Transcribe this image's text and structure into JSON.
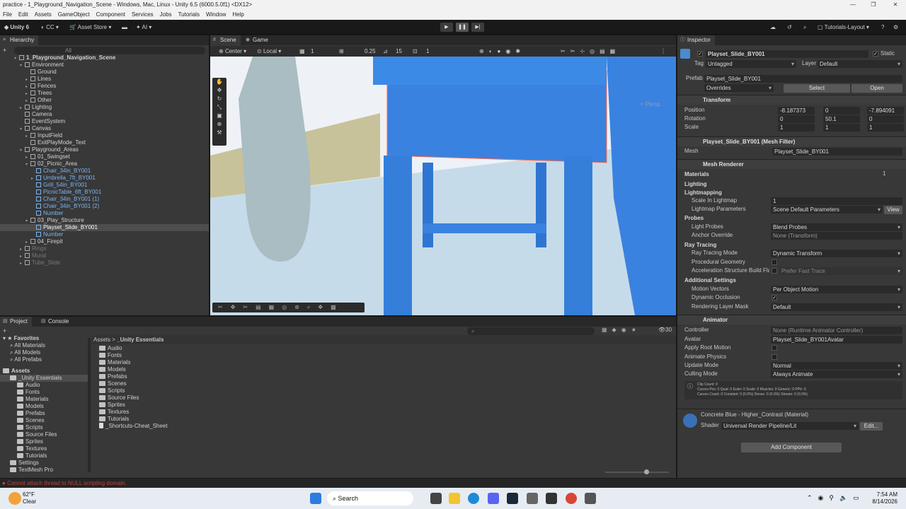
{
  "title": "practice - 1_Playground_Navigation_Scene - Windows, Mac, Linux - Unity 6.5 (6000.5.0f1) <DX12>",
  "menu": [
    "File",
    "Edit",
    "Assets",
    "GameObject",
    "Component",
    "Services",
    "Jobs",
    "Tutorials",
    "Window",
    "Help"
  ],
  "toolbar": {
    "unity": "Unity 6",
    "cc": "CC",
    "asset_store": "Asset Store",
    "ai": "AI",
    "layout": "Tutorials-Layout"
  },
  "hierarchy": {
    "tab": "Hierarchy",
    "search": "All",
    "rows": [
      {
        "t": "1_Playground_Navigation_Scene",
        "d": 0,
        "c": "",
        "a": "▾"
      },
      {
        "t": "Environment",
        "d": 1,
        "c": "",
        "a": "▾"
      },
      {
        "t": "Ground",
        "d": 2,
        "c": "",
        "a": ""
      },
      {
        "t": "Lines",
        "d": 2,
        "c": "",
        "a": "▸"
      },
      {
        "t": "Fences",
        "d": 2,
        "c": "",
        "a": "▸"
      },
      {
        "t": "Trees",
        "d": 2,
        "c": "",
        "a": "▸"
      },
      {
        "t": "Other",
        "d": 2,
        "c": "",
        "a": "▸"
      },
      {
        "t": "Lighting",
        "d": 1,
        "c": "",
        "a": "▸"
      },
      {
        "t": "Camera",
        "d": 1,
        "c": "",
        "a": ""
      },
      {
        "t": "EventSystem",
        "d": 1,
        "c": "",
        "a": ""
      },
      {
        "t": "Canvas",
        "d": 1,
        "c": "",
        "a": "▾"
      },
      {
        "t": "InputField",
        "d": 2,
        "c": "",
        "a": "▸"
      },
      {
        "t": "ExitPlayMode_Text",
        "d": 2,
        "c": "",
        "a": ""
      },
      {
        "t": "Playground_Areas",
        "d": 1,
        "c": "",
        "a": "▾"
      },
      {
        "t": "01_Swingset",
        "d": 2,
        "c": "",
        "a": "▸"
      },
      {
        "t": "02_Picnic_Area",
        "d": 2,
        "c": "",
        "a": "▾"
      },
      {
        "t": "Chair_34in_BY001",
        "d": 3,
        "c": "blue",
        "a": ""
      },
      {
        "t": "Umbrella_7ft_BY001",
        "d": 3,
        "c": "blue",
        "a": "▸"
      },
      {
        "t": "Grill_54in_BY001",
        "d": 3,
        "c": "blue",
        "a": ""
      },
      {
        "t": "PicnicTable_6ft_BY001",
        "d": 3,
        "c": "blue",
        "a": ""
      },
      {
        "t": "Chair_34in_BY001 (1)",
        "d": 3,
        "c": "blue",
        "a": ""
      },
      {
        "t": "Chair_34in_BY001 (2)",
        "d": 3,
        "c": "blue",
        "a": ""
      },
      {
        "t": "Number",
        "d": 3,
        "c": "blue",
        "a": ""
      },
      {
        "t": "03_Play_Structure",
        "d": 2,
        "c": "",
        "a": "▾"
      },
      {
        "t": "Playset_Slide_BY001",
        "d": 3,
        "c": "sel",
        "a": ""
      },
      {
        "t": "Number",
        "d": 3,
        "c": "blue",
        "a": ""
      },
      {
        "t": "04_Firepit",
        "d": 2,
        "c": "",
        "a": "▸"
      },
      {
        "t": "Rings",
        "d": 1,
        "c": "dim",
        "a": "▸"
      },
      {
        "t": "Mural",
        "d": 1,
        "c": "dim",
        "a": "▸"
      },
      {
        "t": "Tube_Slide",
        "d": 1,
        "c": "dim",
        "a": "▸"
      }
    ]
  },
  "scene": {
    "tab_scene": "Scene",
    "tab_game": "Game",
    "pivot": "Center",
    "space": "Local",
    "grid": "1",
    "snap": "0.25",
    "angle": "15",
    "scale": "1",
    "persp": "< Persp"
  },
  "project": {
    "tab_project": "Project",
    "tab_console": "Console",
    "count": "30",
    "favorites": [
      "Favorites",
      "All Materials",
      "All Models",
      "All Prefabs"
    ],
    "tree": [
      "Assets",
      "_Unity Essentials",
      "Audio",
      "Fonts",
      "Materials",
      "Models",
      "Prefabs",
      "Scenes",
      "Scripts",
      "Source Files",
      "Sprites",
      "Textures",
      "Tutorials",
      "Settings",
      "TextMesh Pro"
    ],
    "crumb_a": "Assets",
    "crumb_b": "_Unity Essentials",
    "files": [
      "Audio",
      "Fonts",
      "Materials",
      "Models",
      "Prefabs",
      "Scenes",
      "Scripts",
      "Source Files",
      "Sprites",
      "Textures",
      "Tutorials",
      "_Shortcuts-Cheat_Sheet"
    ]
  },
  "status": "Cannot attach thread to NULL scripting domain.",
  "inspector": {
    "tab": "Inspector",
    "name": "Playset_Slide_BY001",
    "static": "Static",
    "tag_l": "Tag",
    "tag": "Untagged",
    "layer_l": "Layer",
    "layer": "Default",
    "prefab_l": "Prefab",
    "prefab": "Playset_Slide_BY001",
    "overrides": "Overrides",
    "select": "Select",
    "open": "Open",
    "transform": "Transform",
    "pos_l": "Position",
    "rot_l": "Rotation",
    "scale_l": "Scale",
    "px": "-8.187373",
    "py": "0",
    "pz": "-7.894091",
    "rx": "0",
    "ry": "50.1",
    "rz": "0",
    "sx": "1",
    "sy": "1",
    "sz": "1",
    "meshfilter": "Playset_Slide_BY001 (Mesh Filter)",
    "mesh_l": "Mesh",
    "mesh": "Playset_Slide_BY001",
    "meshrenderer": "Mesh Renderer",
    "materials": "Materials",
    "mat_count": "1",
    "lighting": "Lighting",
    "lightmapping": "Lightmapping",
    "scale_lm_l": "Scale In Lightmap",
    "scale_lm": "1",
    "lm_params_l": "Lightmap Parameters",
    "lm_params": "Scene Default Parameters",
    "view": "View",
    "probes": "Probes",
    "light_probes_l": "Light Probes",
    "light_probes": "Blend Probes",
    "anchor_l": "Anchor Override",
    "anchor": "None (Transform)",
    "raytracing": "Ray Tracing",
    "rt_mode_l": "Ray Tracing Mode",
    "rt_mode": "Dynamic Transform",
    "proc_geo_l": "Procedural Geometry",
    "accel_l": "Acceleration Structure Build Fla",
    "accel": "Prefer Fast Trace",
    "addl": "Additional Settings",
    "mv_l": "Motion Vectors",
    "mv": "Per Object Motion",
    "dyn_occ_l": "Dynamic Occlusion",
    "rlm_l": "Rendering Layer Mask",
    "rlm": "Default",
    "animator": "Animator",
    "controller_l": "Controller",
    "controller": "None (Runtime Animator Controller)",
    "avatar_l": "Avatar",
    "avatar": "Playset_Slide_BY001Avatar",
    "root_l": "Apply Root Motion",
    "physics_l": "Animate Physics",
    "update_l": "Update Mode",
    "update": "Normal",
    "cull_l": "Culling Mode",
    "cull": "Always Animate",
    "info1": "Clip Count: 0",
    "info2": "Curves Pos: 0 Quat: 0 Euler: 0 Scale: 0 Muscles: 0 Generic: 0 PPtr: 0",
    "info3": "Curves Count: 0 Constant: 0 (0.0%) Dense: 0 (0.0%) Stream: 0 (0.0%)",
    "material": "Concrete Blue - Higher_Contrast (Material)",
    "shader_l": "Shader",
    "shader": "Universal Render Pipeline/Lit",
    "edit": "Edit...",
    "add_component": "Add Component"
  },
  "taskbar": {
    "temp": "62°F",
    "weather": "Clear",
    "search": "Search",
    "time": "7:54 AM",
    "date": "8/14/2026"
  }
}
